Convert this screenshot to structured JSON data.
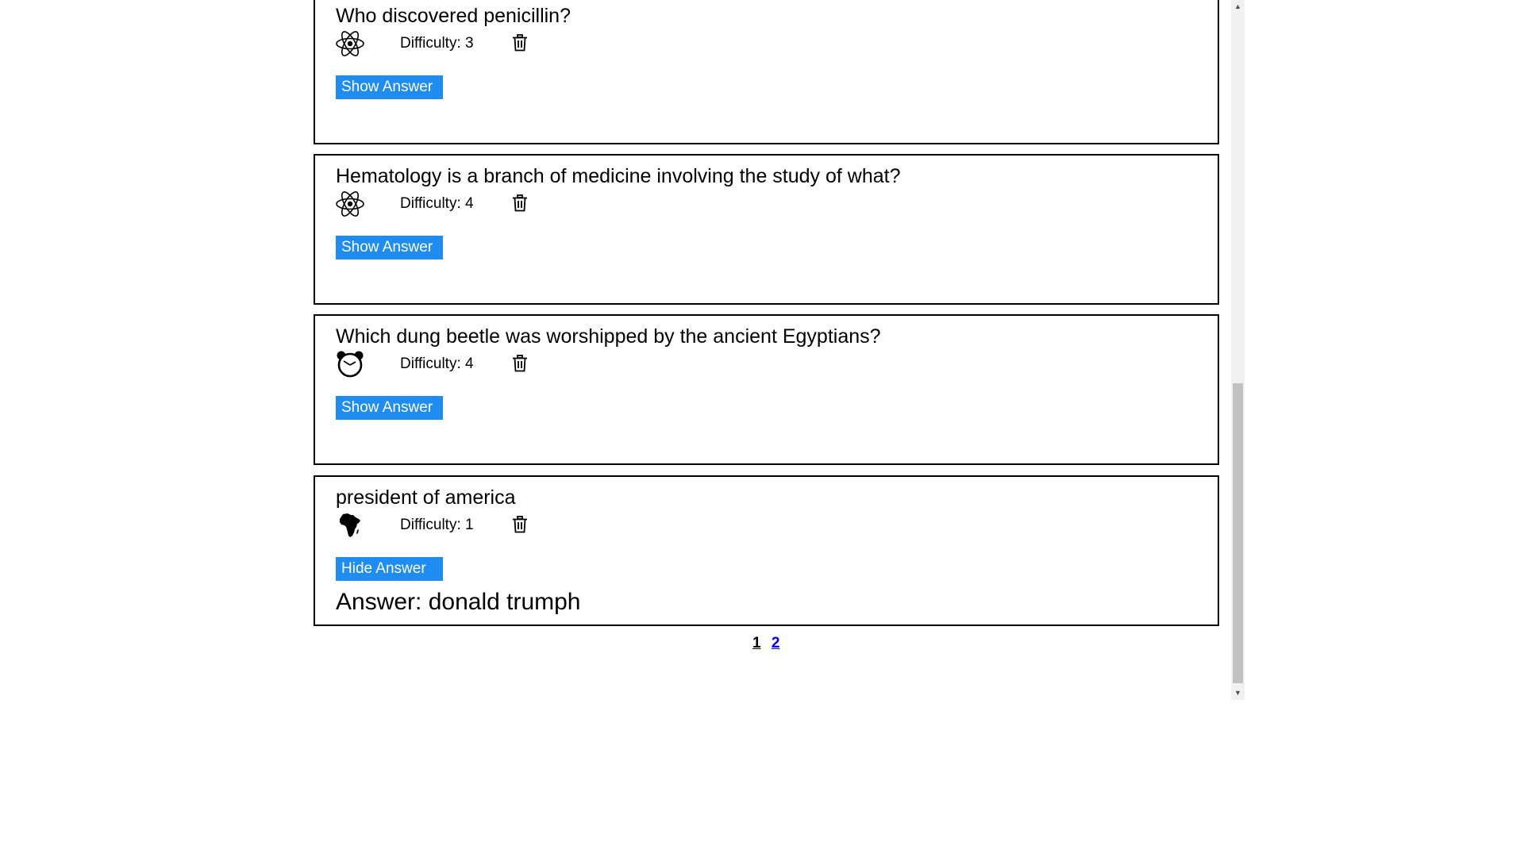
{
  "questions": [
    {
      "question": "Who discovered penicillin?",
      "category_icon": "atom-icon",
      "difficulty_label": "Difficulty: 3",
      "button_label": "Show Answer",
      "answer": ""
    },
    {
      "question": "Hematology is a branch of medicine involving the study of what?",
      "category_icon": "atom-icon",
      "difficulty_label": "Difficulty: 4",
      "button_label": "Show Answer",
      "answer": ""
    },
    {
      "question": "Which dung beetle was worshipped by the ancient Egyptians?",
      "category_icon": "alarm-clock-icon",
      "difficulty_label": "Difficulty: 4",
      "button_label": "Show Answer",
      "answer": ""
    },
    {
      "question": "president of america",
      "category_icon": "africa-icon",
      "difficulty_label": "Difficulty: 1",
      "button_label": "Hide Answer",
      "answer": "Answer: donald trumph"
    }
  ],
  "pagination": {
    "pages": [
      "1",
      "2"
    ],
    "current": "1"
  },
  "colors": {
    "button_bg": "#1e8cf0",
    "link": "#0000ee"
  }
}
